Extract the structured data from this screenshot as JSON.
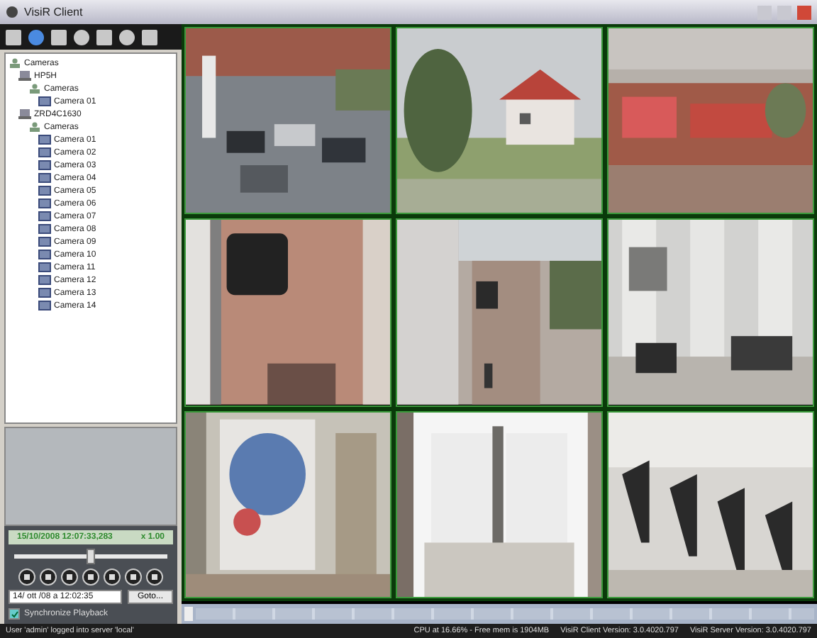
{
  "window": {
    "title": "VisiR Client"
  },
  "tree": [
    {
      "label": "Cameras",
      "kind": "group",
      "children": [
        {
          "label": "HP5H",
          "kind": "server",
          "children": [
            {
              "label": "Cameras",
              "kind": "group",
              "children": [
                {
                  "label": "Camera 01",
                  "kind": "camera"
                }
              ]
            }
          ]
        },
        {
          "label": "ZRD4C1630",
          "kind": "server",
          "children": [
            {
              "label": "Cameras",
              "kind": "group",
              "children": [
                {
                  "label": "Camera 01",
                  "kind": "camera"
                },
                {
                  "label": "Camera 02",
                  "kind": "camera"
                },
                {
                  "label": "Camera 03",
                  "kind": "camera"
                },
                {
                  "label": "Camera 04",
                  "kind": "camera"
                },
                {
                  "label": "Camera 05",
                  "kind": "camera"
                },
                {
                  "label": "Camera 06",
                  "kind": "camera"
                },
                {
                  "label": "Camera 07",
                  "kind": "camera"
                },
                {
                  "label": "Camera 08",
                  "kind": "camera"
                },
                {
                  "label": "Camera 09",
                  "kind": "camera"
                },
                {
                  "label": "Camera 10",
                  "kind": "camera"
                },
                {
                  "label": "Camera 11",
                  "kind": "camera"
                },
                {
                  "label": "Camera 12",
                  "kind": "camera"
                },
                {
                  "label": "Camera 13",
                  "kind": "camera"
                },
                {
                  "label": "Camera 14",
                  "kind": "camera"
                }
              ]
            }
          ]
        }
      ]
    }
  ],
  "playback": {
    "timestamp": "15/10/2008 12:07:33,283",
    "speed": "x 1.00",
    "position": {
      "level": 0.5
    },
    "date_select": "14/ ott /08 a 12:02:35",
    "goto_button": "Goto...",
    "synchronize": {
      "label": "Synchronize Playback",
      "checked": true
    }
  },
  "status_bar": {
    "message": "User 'admin' logged into server 'local'",
    "cpu": "CPU at 16.66% - Free mem is 1904MB",
    "client_version": "VisiR Client Version: 3.0.4020.797",
    "server_version": "VisiR Server Version: 3.0.4020.797"
  }
}
